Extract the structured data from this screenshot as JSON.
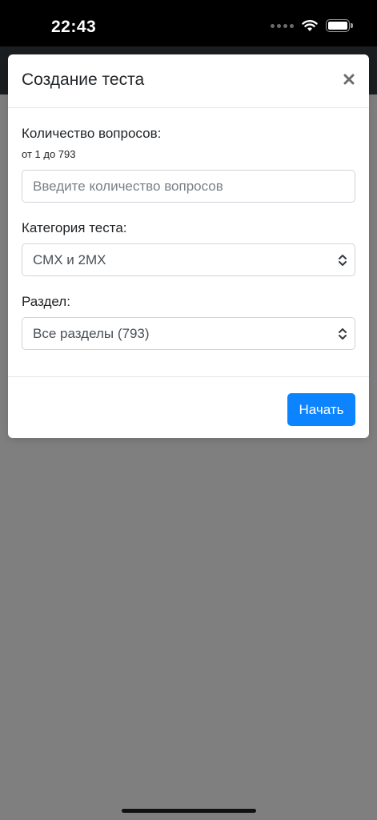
{
  "status_bar": {
    "time": "22:43",
    "icons": [
      "signal-dots-icon",
      "wifi-icon",
      "battery-icon"
    ]
  },
  "modal": {
    "title": "Создание теста",
    "close_icon": "close-icon",
    "questions": {
      "label": "Количество вопросов:",
      "hint": "от 1 до 793",
      "value": "",
      "placeholder": "Введите количество вопросов"
    },
    "category": {
      "label": "Категория теста:",
      "selected": "СМХ и 2МХ"
    },
    "section": {
      "label": "Раздел:",
      "selected": "Все разделы (793)"
    },
    "start_label": "Начать"
  },
  "colors": {
    "primary": "#0d84ff",
    "overlay": "#7f7f7f",
    "status_bar": "#000000"
  }
}
